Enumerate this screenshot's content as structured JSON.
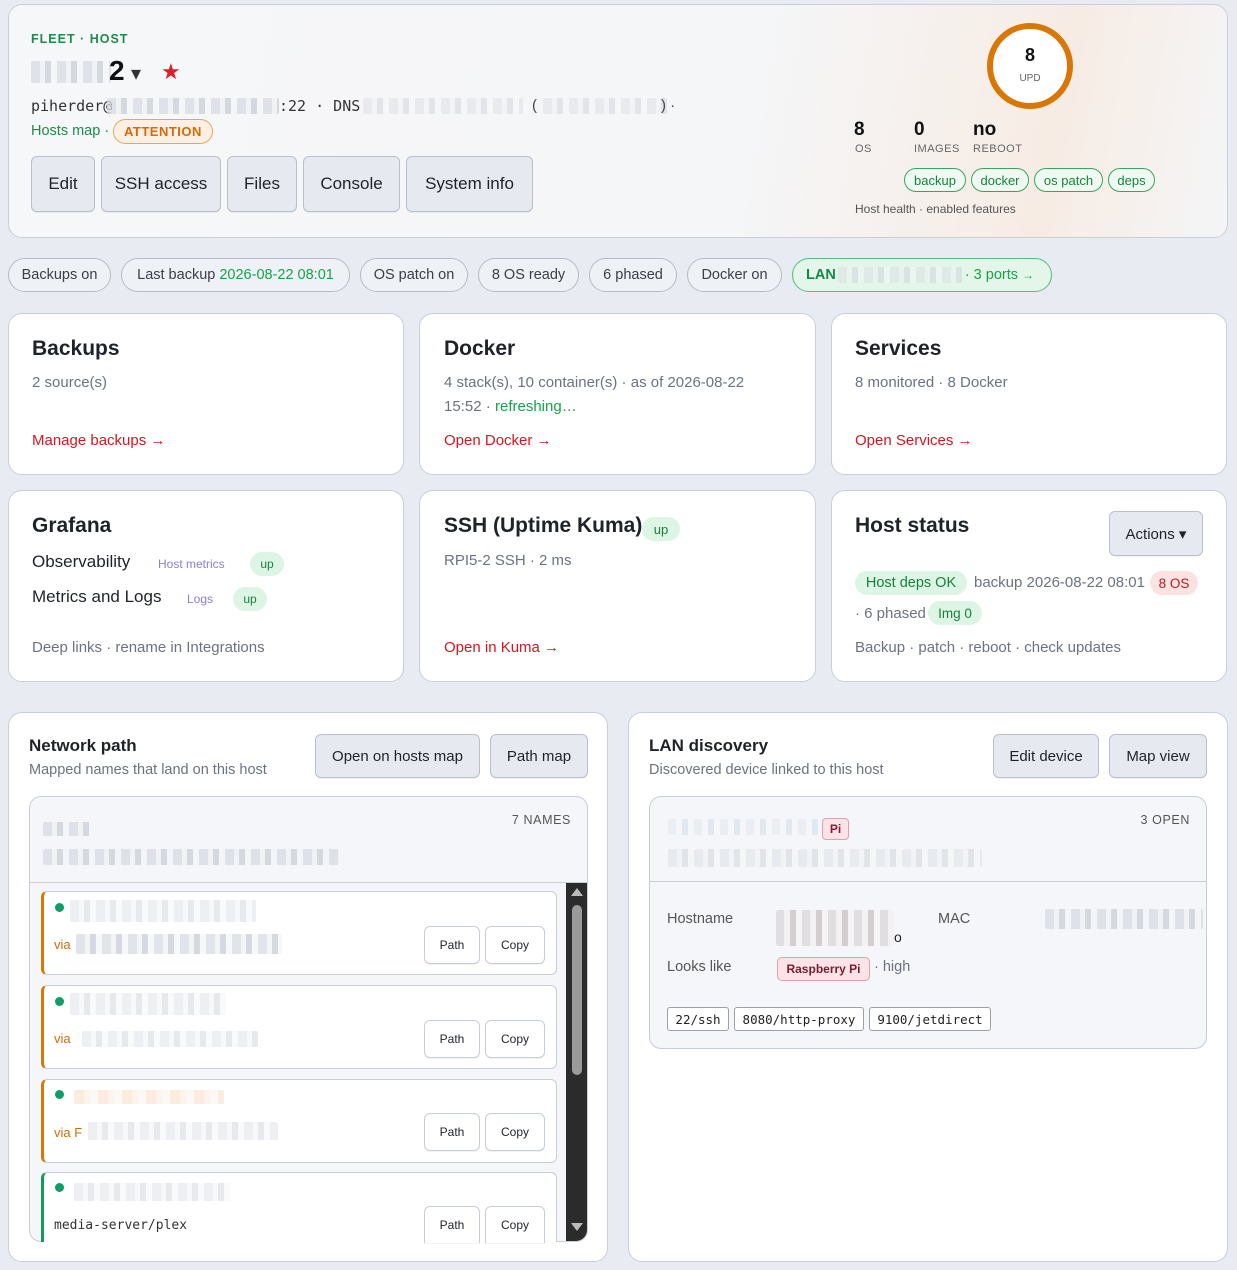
{
  "header": {
    "breadcrumb": "FLEET · HOST",
    "host_name_suffix": "2",
    "dropdown_caret": "▾",
    "favorite_star": "★",
    "ssh_prefix": "piherder@",
    "ssh_port": ":22 · DNS",
    "paren_open": "(",
    "paren_close": ") ·",
    "hosts_map_link": "Hosts map ·",
    "attention_badge": "ATTENTION",
    "buttons": [
      "Edit",
      "SSH access",
      "Files",
      "Console",
      "System info"
    ]
  },
  "summary": {
    "ring_value": "8",
    "ring_label": "UPD",
    "stats": [
      {
        "value": "8",
        "label": "OS"
      },
      {
        "value": "0",
        "label": "IMAGES"
      },
      {
        "value": "no",
        "label": "REBOOT"
      }
    ],
    "feature_tags": [
      "backup",
      "docker",
      "os patch",
      "deps"
    ],
    "footer": "Host health · enabled features"
  },
  "status_pills": {
    "backups_on": "Backups on",
    "last_backup_label": "Last backup",
    "last_backup_value": "2026-08-22 08:01",
    "os_patch_on": "OS patch on",
    "os_ready": "8 OS ready",
    "phased": "6 phased",
    "docker_on": "Docker on",
    "lan_prefix": "LAN",
    "lan_ports": "· 3 ports",
    "lan_arrow": "→"
  },
  "cards": {
    "backups": {
      "title": "Backups",
      "sub": "2 source(s)",
      "link": "Manage backups →"
    },
    "docker": {
      "title": "Docker",
      "sub1": "4 stack(s), 10 container(s) · as of 2026-08-22",
      "sub2_time": "15:52 ·",
      "sub2_refresh": "refreshing…",
      "link": "Open Docker →"
    },
    "services": {
      "title": "Services",
      "sub": "8 monitored · 8 Docker",
      "link": "Open Services →"
    },
    "grafana": {
      "title": "Grafana",
      "rows": [
        {
          "name": "Observability",
          "tag": "Host metrics",
          "status": "up"
        },
        {
          "name": "Metrics and Logs",
          "tag": "Logs",
          "status": "up"
        }
      ],
      "footer": "Deep links · rename in Integrations"
    },
    "ssh": {
      "title": "SSH (Uptime Kuma)",
      "status": "up",
      "sub": "RPI5-2 SSH · 2 ms",
      "link": "Open in Kuma →"
    },
    "host_status": {
      "title": "Host status",
      "actions": "Actions ▾",
      "deps_ok": "Host deps OK",
      "backup_text": "backup 2026-08-22 08:01",
      "os_badge": "8 OS",
      "phased": "· 6 phased",
      "img_badge": "Img 0",
      "footer": "Backup · patch · reboot · check updates"
    }
  },
  "network_path": {
    "title": "Network path",
    "subtitle": "Mapped names that land on this host",
    "btn_hosts_map": "Open on hosts map",
    "btn_path_map": "Path map",
    "names_count": "7 NAMES",
    "items": [
      {
        "via": "via",
        "path": "Path",
        "copy": "Copy"
      },
      {
        "via": "via",
        "path": "Path",
        "copy": "Copy"
      },
      {
        "via": "via F",
        "path": "Path",
        "copy": "Copy"
      },
      {
        "via": "media-server/plex",
        "path": "Path",
        "copy": "Copy"
      }
    ]
  },
  "lan_discovery": {
    "title": "LAN discovery",
    "subtitle": "Discovered device linked to this host",
    "btn_edit": "Edit device",
    "btn_map": "Map view",
    "pi_badge": "Pi",
    "open_count": "3 OPEN",
    "hostname_label": "Hostname",
    "hostname_suffix": "o",
    "mac_label": "MAC",
    "looks_like_label": "Looks like",
    "looks_like_badge": "Raspberry Pi",
    "confidence": "· high",
    "ports": [
      "22/ssh",
      "8080/http-proxy",
      "9100/jetdirect"
    ]
  },
  "colors": {
    "accent_green": "#16a34a",
    "link_red": "#d6161e",
    "ring_orange": "#d97706",
    "attention": "#d97706"
  }
}
